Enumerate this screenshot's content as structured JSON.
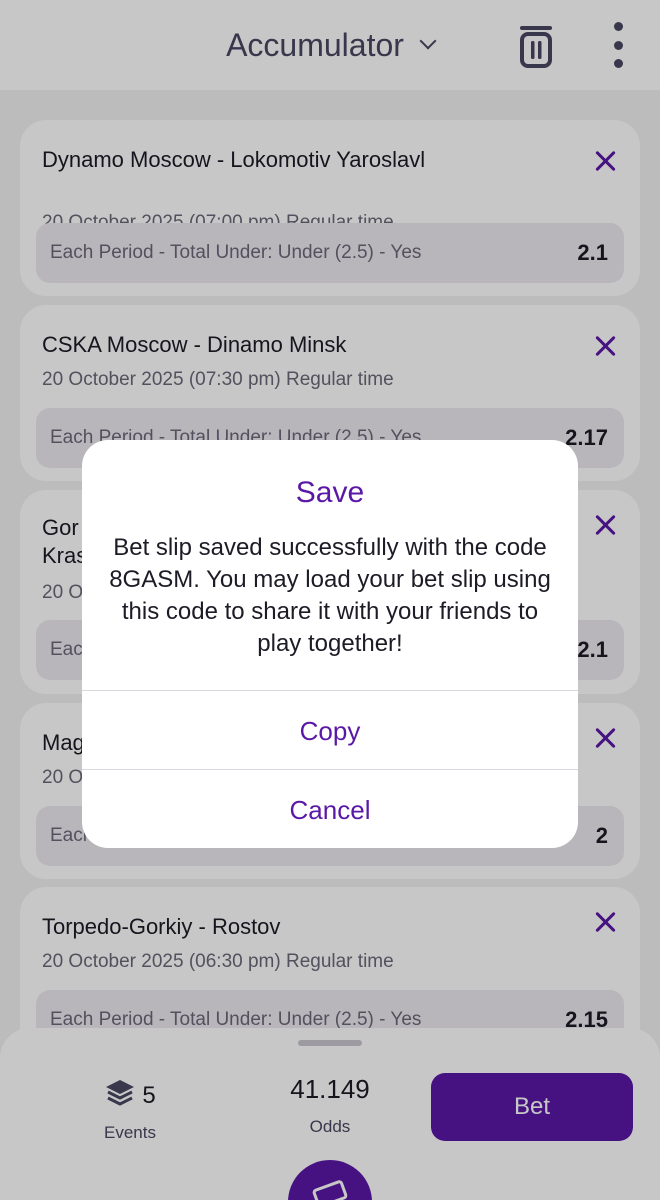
{
  "header": {
    "title": "Accumulator"
  },
  "bets": [
    {
      "match": "Dynamo Moscow - Lokomotiv Yaroslavl",
      "date": "20 October 2025 (07:00 pm) Regular time",
      "market": "Each Period - Total Under: Under (2.5) - Yes",
      "odds": "2.1"
    },
    {
      "match": "CSKA Moscow - Dinamo Minsk",
      "date": "20 October 2025 (07:30 pm) Regular time",
      "market": "Each Period - Total Under: Under (2.5) - Yes",
      "odds": "2.17"
    },
    {
      "match": "Gor",
      "match_line2": "Kras",
      "date": "20 O",
      "market": "Eac",
      "odds": "2.1"
    },
    {
      "match": "Mag",
      "date": "20 O",
      "market": "Each",
      "odds": "2"
    },
    {
      "match": "Torpedo-Gorkiy - Rostov",
      "date": "20 October 2025 (06:30 pm) Regular time",
      "market": "Each Period - Total Under: Under (2.5) - Yes",
      "odds": "2.15"
    }
  ],
  "footer": {
    "events_count": "5",
    "events_label": "Events",
    "odds_value": "41.149",
    "odds_label": "Odds",
    "bet_label": "Bet"
  },
  "dialog": {
    "title": "Save",
    "message": "Bet slip saved successfully with the code 8GASM. You may load your bet slip using this code to share it with your friends to play together!",
    "copy_label": "Copy",
    "cancel_label": "Cancel"
  },
  "colors": {
    "accent": "#5a18a6"
  }
}
